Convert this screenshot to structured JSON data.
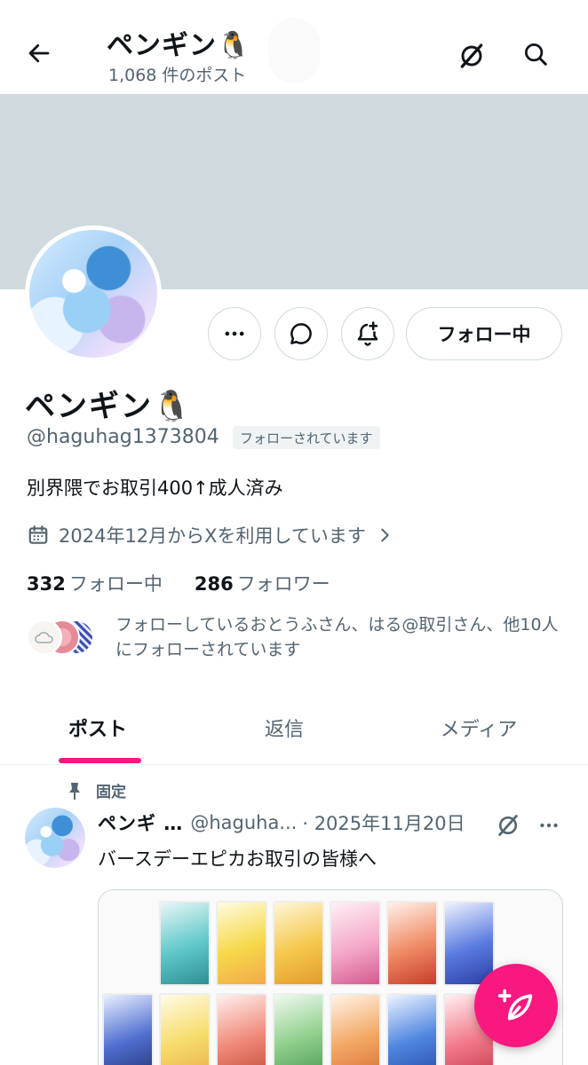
{
  "header": {
    "name": "ペンギン🐧",
    "post_count": "1,068 件のポスト"
  },
  "profile": {
    "display_name": "ペンギン🐧",
    "handle": "@haguhag1373804",
    "follows_you_badge": "フォローされています",
    "bio": "別界隈でお取引400↑成人済み",
    "joined": "2024年12月からXを利用しています",
    "following_count": "332",
    "following_label": "フォロー中",
    "followers_count": "286",
    "followers_label": "フォロワー",
    "known_followers_text": "フォローしているおとうふさん、はる@取引さん、他10人にフォローされています"
  },
  "actions": {
    "follow_label": "フォロー中"
  },
  "tabs": [
    {
      "label": "ポスト",
      "active": true
    },
    {
      "label": "返信",
      "active": false
    },
    {
      "label": "メディア",
      "active": false
    }
  ],
  "post": {
    "pinned_label": "固定",
    "author": "ペンギ …",
    "handle": "@haguha...",
    "date": "· 2025年11月20日",
    "text": "バースデーエピカお取引の皆様へ"
  },
  "colors": {
    "accent": "#f91880",
    "banner": "#cfd9de",
    "muted_text": "#536471"
  },
  "icons": {
    "back": "arrow-left-icon",
    "grok": "grok-icon",
    "search": "search-icon",
    "more": "more-horizontal-icon",
    "message": "message-bubble-icon",
    "notify": "bell-plus-icon",
    "calendar": "calendar-icon",
    "chevron": "chevron-right-icon",
    "pin": "pin-icon",
    "compose": "feather-plus-icon"
  }
}
